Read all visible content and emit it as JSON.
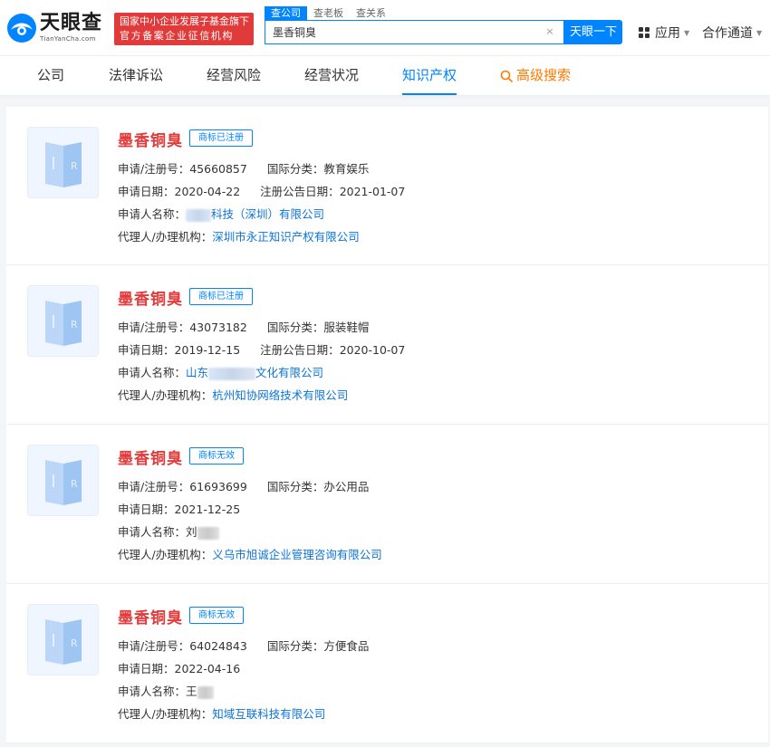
{
  "header": {
    "logo_cn": "天眼查",
    "logo_en": "TianYanCha.com",
    "slogan_line1": "国家中小企业发展子基金旗下",
    "slogan_line2": "官方备案企业征信机构",
    "search_tabs": [
      "查公司",
      "查老板",
      "查关系"
    ],
    "search_value": "墨香铜臭",
    "search_button": "天眼一下",
    "apps_label": "应用",
    "partner_label": "合作通道"
  },
  "nav": {
    "items": [
      "公司",
      "法律诉讼",
      "经营风险",
      "经营状况",
      "知识产权"
    ],
    "advanced": "高级搜索",
    "active_index": 4
  },
  "colors": {
    "accent": "#0084ff",
    "title_red": "#e33b3b",
    "link_blue": "#0b74d8"
  },
  "labels": {
    "reg_no": "申请/注册号：",
    "intl_class": "国际分类：",
    "apply_date": "申请日期：",
    "announce_date": "注册公告日期：",
    "applicant": "申请人名称：",
    "agent": "代理人/办理机构："
  },
  "trademarks": [
    {
      "name": "墨香铜臭",
      "status": "商标已注册",
      "reg_no": "45660857",
      "intl_class": "教育娱乐",
      "apply_date": "2020-04-22",
      "announce_date": "2021-01-07",
      "applicant_visible": "科技（深圳）有限公司",
      "agent": "深圳市永正知识产权有限公司"
    },
    {
      "name": "墨香铜臭",
      "status": "商标已注册",
      "reg_no": "43073182",
      "intl_class": "服装鞋帽",
      "apply_date": "2019-12-15",
      "announce_date": "2020-10-07",
      "applicant_prefix": "山东",
      "applicant_visible": "文化有限公司",
      "agent": "杭州知协网络技术有限公司"
    },
    {
      "name": "墨香铜臭",
      "status": "商标无效",
      "reg_no": "61693699",
      "intl_class": "办公用品",
      "apply_date": "2021-12-25",
      "applicant_prefix": "刘",
      "agent": "义乌市旭诚企业管理咨询有限公司"
    },
    {
      "name": "墨香铜臭",
      "status": "商标无效",
      "reg_no": "64024843",
      "intl_class": "方便食品",
      "apply_date": "2022-04-16",
      "applicant_prefix": "王",
      "agent": "知域互联科技有限公司"
    }
  ]
}
